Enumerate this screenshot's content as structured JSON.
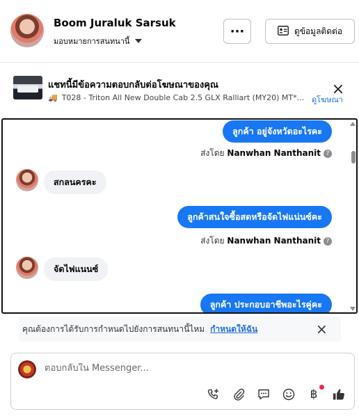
{
  "header": {
    "name": "Boom Juraluk Sarsuk",
    "assign_label": "มอบหมายการสนทนานี้",
    "more_label": "···",
    "contact_label": "ดูข้อมูลติดต่อ"
  },
  "ad": {
    "title": "แชทนี้มีข้อความตอบกลับต่อโฆษณาของคุณ",
    "vehicle_icon": "🚚",
    "subtitle": "T028 - Triton All New Double Cab 2.5 GLX Ralliart (MY20) MT*...",
    "link_label": "ดูโฆษณา"
  },
  "messages": [
    {
      "direction": "out",
      "text": "ลูกค้า  อยู่จังหวัดอะไรคะ"
    },
    {
      "direction": "meta",
      "prefix": "ส่งโดย",
      "sender": "Nanwhan Nanthanit"
    },
    {
      "direction": "in",
      "text": "สกลนครคะ"
    },
    {
      "direction": "out",
      "text": "ลูกค้าสนใจซื้อสดหรือจัดไฟแน่นซ์คะ"
    },
    {
      "direction": "meta",
      "prefix": "ส่งโดย",
      "sender": "Nanwhan Nanthanit"
    },
    {
      "direction": "in",
      "text": "จัดไฟแนนซ์"
    },
    {
      "direction": "out",
      "text": "ลูกค้า  ประกอบอาชีพอะไรคู่คะ"
    }
  ],
  "prompt": {
    "text": "คุณต้องการได้รับการกำหนดไปยังการสนทนานี้ไหม",
    "link_label": "กำหนดให้ฉัน"
  },
  "composer": {
    "placeholder": "ตอบกลับใน Messenger..."
  },
  "tool_icons": [
    "phone-add-icon",
    "attachment-icon",
    "saved-reply-icon",
    "emoji-icon",
    "baht-icon",
    "thumbs-up-icon"
  ],
  "baht_symbol": "฿",
  "colors": {
    "accent": "#1877f2",
    "link": "#1d6fe0",
    "bubble_in": "#f0f2f5",
    "notification": "#f02849"
  }
}
